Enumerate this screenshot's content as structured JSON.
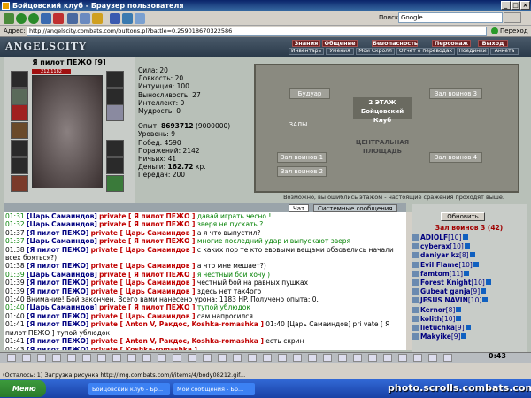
{
  "window": {
    "title": "Бойцовский клуб - Браузер пользователя"
  },
  "search": {
    "label": "Поиск:",
    "value": "Google"
  },
  "address": {
    "label": "Адрес:",
    "url": "http://angelscity.combats.com/buttons.pl?battle=0.259018670322586",
    "go": "Переход"
  },
  "site": {
    "logo": "ANGELSCITY"
  },
  "nav_top": [
    "Знания",
    "Общение",
    "Безопасность",
    "Персонаж",
    "Выход"
  ],
  "nav_bottom": [
    "Инвентарь",
    "Умения",
    "Мой Скролл",
    "Отчет о переводах",
    "Поединки",
    "Анкета"
  ],
  "character": {
    "name": "Я пилот ПЕЖО",
    "level": "[9]",
    "hp": "212/1182"
  },
  "stats": {
    "strength": "Сила: 20",
    "agility": "Ловкость: 20",
    "intuition": "Интуиция: 100",
    "endurance": "Выносливость: 27",
    "intellect": "Интеллект: 0",
    "wisdom": "Мудрость: 0",
    "exp_label": "Опыт:",
    "exp_value": "8693712",
    "exp_next": "(9000000)",
    "level": "Уровень: 9",
    "wins": "Побед: 4590",
    "losses": "Поражений: 2142",
    "draws": "Ничьих: 41",
    "money_label": "Деньги:",
    "money_value": "162.72",
    "money_unit": "кр.",
    "transfers": "Передач: 200"
  },
  "map": {
    "floor": "2 ЭТАЖ",
    "club": "Бойцовский Клуб",
    "plaza": "ЦЕНТРАЛЬНАЯ ПЛОЩАДЬ",
    "rooms": [
      "Будуар",
      "Зал воинов 3",
      "ЗАЛЫ",
      "Зал воинов 1",
      "Зал воинов 2",
      "Зал воинов 4"
    ],
    "caption": "Возможно, вы ошиблись этажом - настоящие сражения проходят выше."
  },
  "chat_tabs": [
    "Чат",
    "Системные сообщения"
  ],
  "chat": [
    {
      "t": "01:31",
      "n": "[Царь Самаиндов]",
      "p": "private [ Я пилот ПЕЖО ]",
      "m": "давай играть чесно !",
      "c": "gm"
    },
    {
      "t": "01:32",
      "n": "[Царь Самаиндов]",
      "p": "private [ Я пилот ПЕЖО ]",
      "m": "зверя не пускать ?",
      "c": "gm"
    },
    {
      "t": "01:37",
      "n": "[Я пилот ПЕЖО]",
      "p": "private [ Царь Самаиндов ]",
      "m": "а я что выпустил?",
      "c": "m"
    },
    {
      "t": "01:37",
      "n": "[Царь Самаиндов]",
      "p": "private [ Я пилот ПЕЖО ]",
      "m": "многие последний удар и выпускают зверя",
      "c": "gm"
    },
    {
      "t": "01:38",
      "n": "[Я пилот ПЕЖО]",
      "p": "private [ Царь Самаиндов ]",
      "m": "с каких пор те кто евовыми вещами обзовелись начали",
      "c": "m"
    },
    {
      "t": "",
      "n": "",
      "p": "",
      "m": "всех бояться?)",
      "c": "m"
    },
    {
      "t": "01:38",
      "n": "[Я пилот ПЕЖО]",
      "p": "private [ Царь Самаиндов ]",
      "m": "а что мне мешает?)",
      "c": "m"
    },
    {
      "t": "01:39",
      "n": "[Царь Самаиндов]",
      "p": "private [ Я пилот ПЕЖО ]",
      "m": "я честный бой хочу )",
      "c": "gm"
    },
    {
      "t": "01:39",
      "n": "[Я пилот ПЕЖО]",
      "p": "private [ Царь Самаиндов ]",
      "m": "честный бой на равных пушках",
      "c": "m"
    },
    {
      "t": "01:39",
      "n": "[Я пилот ПЕЖО]",
      "p": "private [ Царь Самаиндов ]",
      "m": "здесь нет так4ого",
      "c": "m"
    },
    {
      "t": "01:40",
      "n": "",
      "p": "",
      "m": "Внимание! Бой закончен. Всего вами нанесено урона: 1183 HP. Получено опыта: 0.",
      "c": "m"
    },
    {
      "t": "01:40",
      "n": "[Царь Самаиндов]",
      "p": "private [ Я пилот ПЕЖО ]",
      "m": "тупой ублюдок",
      "c": "gm"
    },
    {
      "t": "01:40",
      "n": "[Я пилот ПЕЖО]",
      "p": "private [ Царь Самаиндов ]",
      "m": "сам напросился",
      "c": "m"
    },
    {
      "t": "01:41",
      "n": "[Я пилот ПЕЖО]",
      "p": "private [ Anton V, Ракдос, Koshka-romashka ]",
      "m": "01:40 [Царь Самаиндов] pri vate [ Я",
      "c": "m"
    },
    {
      "t": "",
      "n": "",
      "p": "",
      "m": "пилот ПЕЖО ]  тупой ублюдок",
      "c": "m"
    },
    {
      "t": "01:41",
      "n": "[Я пилот ПЕЖО]",
      "p": "private [ Anton V, Ракдос, Koshka-romashka ]",
      "m": "есть скрин",
      "c": "m"
    },
    {
      "t": "01:43",
      "n": "[Я пилот ПЕЖО]",
      "p": "private [ Koshka-romashka ]",
      "m": "",
      "c": "m"
    }
  ],
  "online": {
    "refresh": "Обновить",
    "title": "Зал воинов 3 (42)",
    "users": [
      {
        "name": "ADIOLF",
        "lvl": "[10]"
      },
      {
        "name": "cyberax",
        "lvl": "[10]"
      },
      {
        "name": "daniyar kz",
        "lvl": "[8]"
      },
      {
        "name": "Evil Flame",
        "lvl": "[10]"
      },
      {
        "name": "famtom",
        "lvl": "[11]"
      },
      {
        "name": "Forest Knight",
        "lvl": "[10]"
      },
      {
        "name": "Gubeat ganja",
        "lvl": "[9]"
      },
      {
        "name": "JESUS NAVIN",
        "lvl": "[10]"
      },
      {
        "name": "Kernor",
        "lvl": "[8]"
      },
      {
        "name": "kolith",
        "lvl": "[10]"
      },
      {
        "name": "lietuchka",
        "lvl": "[9]"
      },
      {
        "name": "Makyike",
        "lvl": "[9]"
      }
    ]
  },
  "clock": "0:43",
  "statusbar": "(Осталось: 1) Загрузка рисунка http://img.combats.com/i/items/4/body08212.gif...",
  "taskbar": {
    "start": "Меню",
    "tasks": [
      "Бойцовский клуб - Бр...",
      "Мои сообщения - Бр..."
    ],
    "watermark": "photo.scrolls.combats.com"
  },
  "colors": {
    "private": "#c00000",
    "nick": "#000080",
    "time_green": "#008000",
    "titlebar": "#0a246a"
  }
}
